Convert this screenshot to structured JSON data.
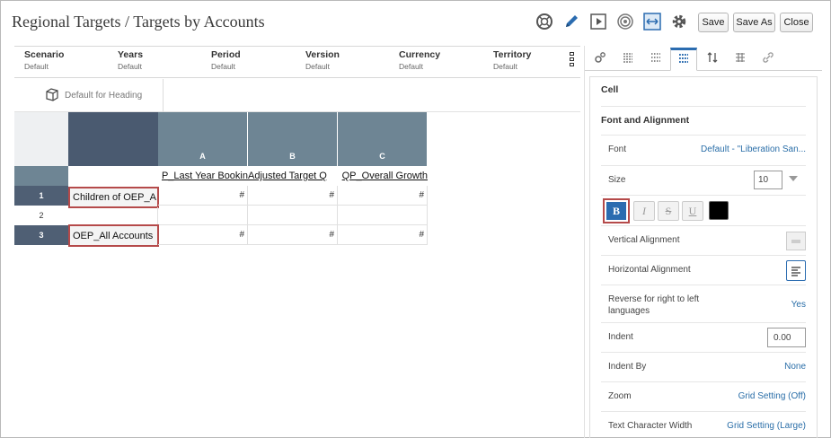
{
  "title": "Regional Targets / Targets by Accounts",
  "toolbar": {
    "save": "Save",
    "save_as": "Save As",
    "close": "Close"
  },
  "pov": [
    {
      "name": "Scenario",
      "value": "Default"
    },
    {
      "name": "Years",
      "value": "Default"
    },
    {
      "name": "Period",
      "value": "Default"
    },
    {
      "name": "Version",
      "value": "Default"
    },
    {
      "name": "Currency",
      "value": "Default"
    },
    {
      "name": "Territory",
      "value": "Default"
    }
  ],
  "heading_button": "Default for Heading",
  "grid": {
    "columns": [
      "A",
      "B",
      "C"
    ],
    "column_members": [
      "OEP_Last Year Bookings",
      "Adjusted Target Quota",
      "OEP_Overall Growth%"
    ],
    "column_members_visible": [
      "P_Last Year Bookin",
      "Adjusted Target Q",
      "QP_Overall Growth"
    ],
    "rows": [
      {
        "num": "1",
        "label": "Children of OEP_A",
        "values": [
          "#",
          "#",
          "#"
        ]
      },
      {
        "num": "2",
        "label": "",
        "values": [
          "",
          "",
          ""
        ]
      },
      {
        "num": "3",
        "label": "OEP_All Accounts",
        "values": [
          "#",
          "#",
          "#"
        ]
      }
    ]
  },
  "panel": {
    "section_cell": "Cell",
    "section_font": "Font and Alignment",
    "font_label": "Font",
    "font_value": "Default - \"Liberation San...",
    "size_label": "Size",
    "size_value": "10",
    "bold": "B",
    "italic": "I",
    "strike": "S",
    "underline": "U",
    "vertical_alignment": "Vertical Alignment",
    "horizontal_alignment": "Horizontal Alignment",
    "rtl_label": "Reverse for right to left languages",
    "rtl_value": "Yes",
    "indent_label": "Indent",
    "indent_value": "0.00",
    "indent_by_label": "Indent By",
    "indent_by_value": "None",
    "zoom_label": "Zoom",
    "zoom_value": "Grid Setting (Off)",
    "text_width_label": "Text Character Width",
    "text_width_value": "Grid Setting (Large)"
  },
  "colors": {
    "accent": "#2b6cb0",
    "header_dark": "#4a5a70",
    "header_col": "#6e8594",
    "highlight": "#b54a4a"
  }
}
